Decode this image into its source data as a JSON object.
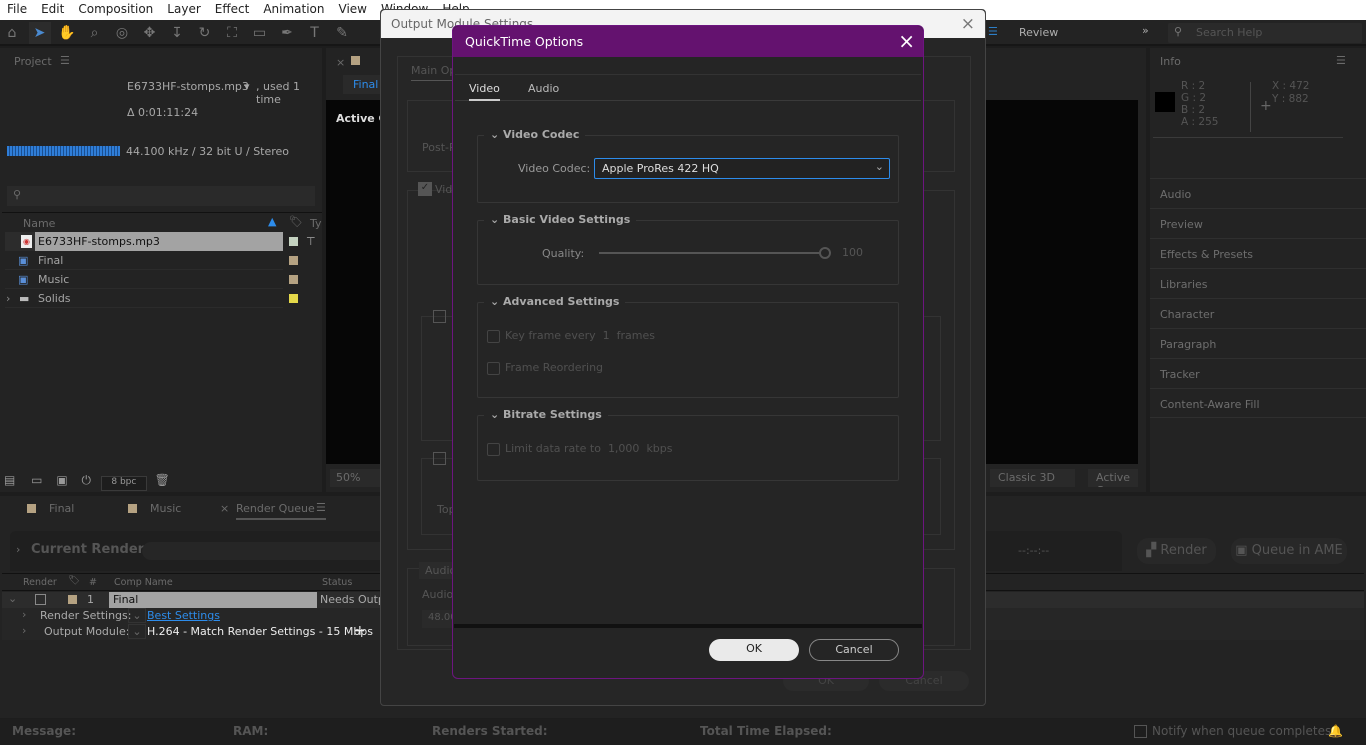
{
  "menu": [
    "File",
    "Edit",
    "Composition",
    "Layer",
    "Effect",
    "Animation",
    "View",
    "Window",
    "Help"
  ],
  "toolbar": {
    "review": "Review",
    "search_placeholder": "Search Help"
  },
  "project": {
    "title": "Project",
    "file_name": "E6733HF-stomps.mp3",
    "used": ", used 1 time",
    "duration": "Δ 0:01:11:24",
    "audio_info": "44.100 kHz / 32 bit U / Stereo",
    "col_name": "Name",
    "col_type": "Ty",
    "bpc": "8 bpc",
    "items": [
      {
        "name": "E6733HF-stomps.mp3",
        "color": "#c4d2c0"
      },
      {
        "name": "Final",
        "color": "#b5a282"
      },
      {
        "name": "Music",
        "color": "#b5a282"
      },
      {
        "name": "Solids",
        "color": "#e4d84a"
      }
    ]
  },
  "comp": {
    "tab": "Final",
    "active_camera": "Active Ca",
    "zoom": "50%",
    "renderer": "Classic 3D",
    "camera_sel": "Active Ca"
  },
  "info": {
    "title": "Info",
    "r": "2",
    "g": "2",
    "b": "2",
    "a": "255",
    "x": "472",
    "y": "882"
  },
  "right_panels": [
    "Audio",
    "Preview",
    "Effects & Presets",
    "Libraries",
    "Character",
    "Paragraph",
    "Tracker",
    "Content-Aware Fill"
  ],
  "bottom_tabs": [
    "Final",
    "Music",
    "Render Queue"
  ],
  "render_queue": {
    "current_render": "Current Render",
    "time": "--:--:--",
    "render_btn": "Render",
    "ame_btn": "Queue in AME",
    "cols": [
      "Render",
      "#",
      "Comp Name",
      "Status"
    ],
    "item": {
      "num": "1",
      "comp": "Final",
      "status": "Needs Output",
      "render_settings_label": "Render Settings:",
      "render_settings": "Best Settings",
      "output_module_label": "Output Module:",
      "output_module": "H.264 - Match Render Settings - 15 Mbps"
    }
  },
  "status_bar": {
    "message": "Message:",
    "ram": "RAM:",
    "renders_started": "Renders Started:",
    "elapsed": "Total Time Elapsed:",
    "notify": "Notify when queue completes"
  },
  "output_module": {
    "title": "Output Module Settings",
    "main_tab": "Main Op",
    "post": "Post-R",
    "video": "Vid",
    "top": "Top",
    "audio_tab": "Audio",
    "audio_label": "Audio",
    "audio_rate": "48.00",
    "ok": "OK",
    "cancel": "Cancel"
  },
  "quicktime": {
    "title": "QuickTime Options",
    "tabs": [
      "Video",
      "Audio"
    ],
    "active_tab": "Video",
    "video_codec_header": "Video Codec",
    "video_codec_label": "Video Codec:",
    "video_codec": "Apple ProRes 422 HQ",
    "basic_header": "Basic Video Settings",
    "quality_label": "Quality:",
    "quality": 100,
    "quality_text": "100",
    "advanced_header": "Advanced Settings",
    "keyframe_pre": "Key frame every",
    "keyframe_value": "1",
    "keyframe_post": "frames",
    "frame_reordering": "Frame Reordering",
    "bitrate_header": "Bitrate Settings",
    "limit_pre": "Limit data rate to",
    "limit_value": "1,000",
    "limit_unit": "kbps",
    "ok": "OK",
    "cancel": "Cancel"
  },
  "colors": {
    "accent": "#2d8ceb",
    "dialog_title": "#64126f"
  }
}
